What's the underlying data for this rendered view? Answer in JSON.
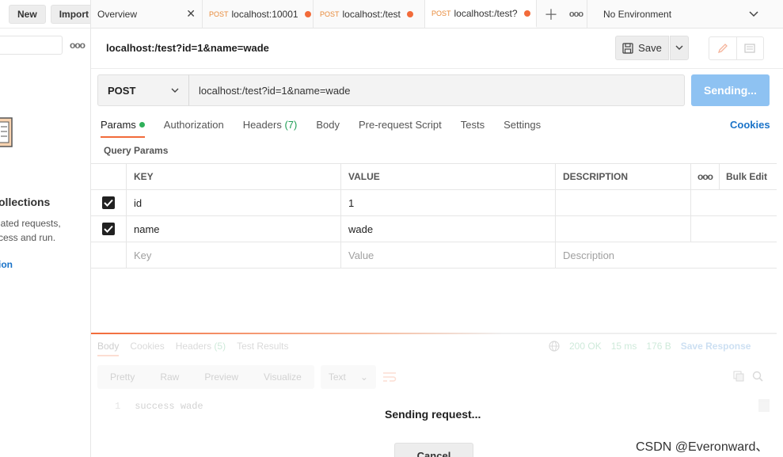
{
  "sidebar": {
    "new_label": "New",
    "import_label": "Import",
    "empty_title": "ollections",
    "empty_desc_line1": "lated requests,",
    "empty_desc_line2": "cess and run.",
    "create_link": "ion"
  },
  "tabs": [
    {
      "method": "",
      "label": "Overview"
    },
    {
      "method": "POST",
      "label": "localhost:10001"
    },
    {
      "method": "POST",
      "label": "localhost:/test"
    },
    {
      "method": "POST",
      "label": "localhost:/test?"
    }
  ],
  "environment": {
    "label": "No Environment"
  },
  "request": {
    "title": "localhost:/test?id=1&name=wade",
    "save_label": "Save",
    "method": "POST",
    "url": "localhost:/test?id=1&name=wade",
    "send_label": "Sending..."
  },
  "subtabs": {
    "params": "Params",
    "authorization": "Authorization",
    "headers": "Headers",
    "headers_count": "(7)",
    "body": "Body",
    "prerequest": "Pre-request Script",
    "tests": "Tests",
    "settings": "Settings",
    "cookies": "Cookies"
  },
  "query_params": {
    "label": "Query Params",
    "columns": {
      "key": "KEY",
      "value": "VALUE",
      "description": "DESCRIPTION",
      "bulk_edit": "Bulk Edit"
    },
    "rows": [
      {
        "key": "id",
        "value": "1",
        "description": ""
      },
      {
        "key": "name",
        "value": "wade",
        "description": ""
      }
    ],
    "placeholder": {
      "key": "Key",
      "value": "Value",
      "description": "Description"
    }
  },
  "response": {
    "tabs": {
      "body": "Body",
      "cookies": "Cookies",
      "headers": "Headers",
      "headers_count": "(5)",
      "test_results": "Test Results"
    },
    "status": "200 OK",
    "time": "15 ms",
    "size": "176 B",
    "save_response": "Save Response",
    "view_modes": {
      "pretty": "Pretty",
      "raw": "Raw",
      "preview": "Preview",
      "visualize": "Visualize"
    },
    "format": "Text",
    "line_no": "1",
    "body_text": "success wade"
  },
  "overlay": {
    "sending_text": "Sending request...",
    "cancel_label": "Cancel"
  },
  "watermark": "CSDN @Everonward、"
}
